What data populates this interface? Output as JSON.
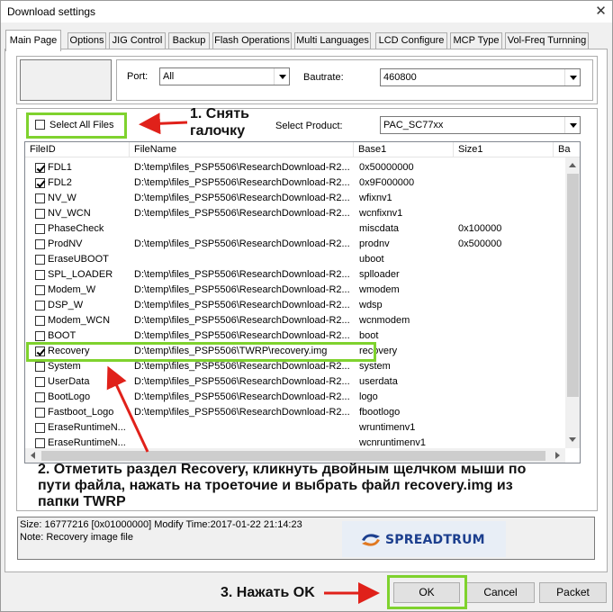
{
  "window": {
    "title": "Download settings"
  },
  "tabs": [
    {
      "label": "Main Page",
      "active": true
    },
    {
      "label": "Options"
    },
    {
      "label": "JIG Control"
    },
    {
      "label": "Backup"
    },
    {
      "label": "Flash Operations"
    },
    {
      "label": "Multi Languages"
    },
    {
      "label": "LCD Configure"
    },
    {
      "label": "MCP Type"
    },
    {
      "label": "Vol-Freq Turnning"
    }
  ],
  "port": {
    "label": "Port:",
    "value": "All"
  },
  "baudrate": {
    "label": "Bautrate:",
    "value": "460800"
  },
  "select_all": {
    "label": "Select All Files",
    "checked": false
  },
  "product": {
    "label": "Select Product:",
    "value": "PAC_SC77xx"
  },
  "columns": [
    "FileID",
    "FileName",
    "Base1",
    "Size1",
    "Ba"
  ],
  "rows": [
    {
      "checked": true,
      "id": "FDL1",
      "file": "D:\\temp\\files_PSP5506\\ResearchDownload-R2...",
      "base": "0x50000000",
      "size": ""
    },
    {
      "checked": true,
      "id": "FDL2",
      "file": "D:\\temp\\files_PSP5506\\ResearchDownload-R2...",
      "base": "0x9F000000",
      "size": ""
    },
    {
      "checked": false,
      "id": "NV_W",
      "file": "D:\\temp\\files_PSP5506\\ResearchDownload-R2...",
      "base": "wfixnv1",
      "size": ""
    },
    {
      "checked": false,
      "id": "NV_WCN",
      "file": "D:\\temp\\files_PSP5506\\ResearchDownload-R2...",
      "base": "wcnfixnv1",
      "size": ""
    },
    {
      "checked": false,
      "id": "PhaseCheck",
      "file": "",
      "base": "miscdata",
      "size": "0x100000"
    },
    {
      "checked": false,
      "id": "ProdNV",
      "file": "D:\\temp\\files_PSP5506\\ResearchDownload-R2...",
      "base": "prodnv",
      "size": "0x500000"
    },
    {
      "checked": false,
      "id": "EraseUBOOT",
      "file": "",
      "base": "uboot",
      "size": ""
    },
    {
      "checked": false,
      "id": "SPL_LOADER",
      "file": "D:\\temp\\files_PSP5506\\ResearchDownload-R2...",
      "base": "splloader",
      "size": ""
    },
    {
      "checked": false,
      "id": "Modem_W",
      "file": "D:\\temp\\files_PSP5506\\ResearchDownload-R2...",
      "base": "wmodem",
      "size": ""
    },
    {
      "checked": false,
      "id": "DSP_W",
      "file": "D:\\temp\\files_PSP5506\\ResearchDownload-R2...",
      "base": "wdsp",
      "size": ""
    },
    {
      "checked": false,
      "id": "Modem_WCN",
      "file": "D:\\temp\\files_PSP5506\\ResearchDownload-R2...",
      "base": "wcnmodem",
      "size": ""
    },
    {
      "checked": false,
      "id": "BOOT",
      "file": "D:\\temp\\files_PSP5506\\ResearchDownload-R2...",
      "base": "boot",
      "size": ""
    },
    {
      "checked": true,
      "id": "Recovery",
      "file": "D:\\temp\\files_PSP5506\\TWRP\\recovery.img",
      "base": "recovery",
      "size": ""
    },
    {
      "checked": false,
      "id": "System",
      "file": "D:\\temp\\files_PSP5506\\ResearchDownload-R2...",
      "base": "system",
      "size": ""
    },
    {
      "checked": false,
      "id": "UserData",
      "file": "D:\\temp\\files_PSP5506\\ResearchDownload-R2...",
      "base": "userdata",
      "size": ""
    },
    {
      "checked": false,
      "id": "BootLogo",
      "file": "D:\\temp\\files_PSP5506\\ResearchDownload-R2...",
      "base": "logo",
      "size": ""
    },
    {
      "checked": false,
      "id": "Fastboot_Logo",
      "file": "D:\\temp\\files_PSP5506\\ResearchDownload-R2...",
      "base": "fbootlogo",
      "size": ""
    },
    {
      "checked": false,
      "id": "EraseRuntimeN...",
      "file": "",
      "base": "wruntimenv1",
      "size": ""
    },
    {
      "checked": false,
      "id": "EraseRuntimeN...",
      "file": "",
      "base": "wcnruntimenv1",
      "size": ""
    }
  ],
  "status": {
    "line1": "Size: 16777216 [0x01000000] Modify Time:2017-01-22 21:14:23",
    "line2": "Note: Recovery image file"
  },
  "logo": {
    "text": "SPREADTRUM"
  },
  "buttons": {
    "ok": "OK",
    "cancel": "Cancel",
    "packet": "Packet"
  },
  "annotations": {
    "step1_line1": "1. Снять",
    "step1_line2": "галочку",
    "step2_line1": "2. Отметить раздел Recovery, кликнуть двойным щелчком мыши по",
    "step2_line2": "пути файла, нажать на троеточие и выбрать файл recovery.img из",
    "step2_line3": "папки TWRP",
    "step3": "3. Нажать OK"
  },
  "colors": {
    "highlight": "#7fd22e",
    "arrow": "#e0211a"
  }
}
